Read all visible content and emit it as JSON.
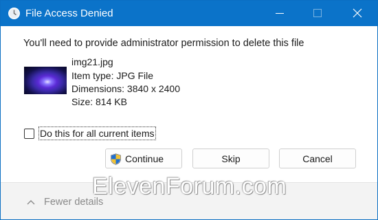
{
  "window": {
    "title": "File Access Denied",
    "title_icon": "clock-icon",
    "accent_color": "#0b73c9"
  },
  "message": "You'll need to provide administrator permission to delete this file",
  "file": {
    "name": "img21.jpg",
    "type": "Item type: JPG File",
    "dimensions": "Dimensions: 3840 x 2400",
    "size": "Size: 814 KB"
  },
  "options": {
    "all_items_label": "Do this for all current items",
    "all_items_checked": false
  },
  "buttons": {
    "continue": "Continue",
    "skip": "Skip",
    "cancel": "Cancel"
  },
  "footer": {
    "details_label": "Fewer details"
  },
  "watermark": "ElevenForum.com"
}
